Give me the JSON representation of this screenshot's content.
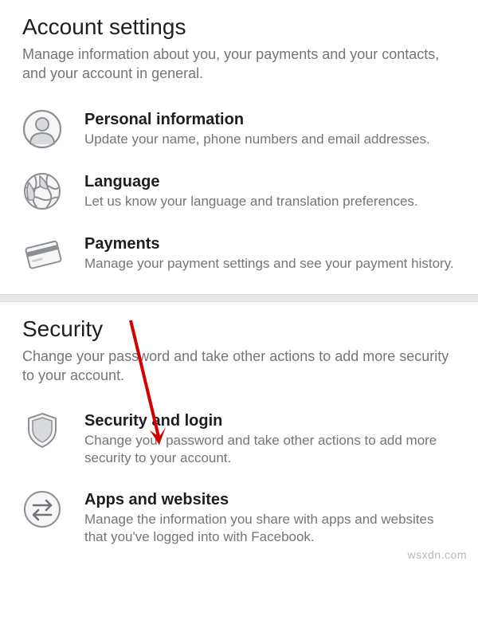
{
  "sections": [
    {
      "title": "Account settings",
      "desc": "Manage information about you, your payments and your contacts, and your account in general.",
      "items": [
        {
          "title": "Personal information",
          "desc": "Update your name, phone numbers and email addresses."
        },
        {
          "title": "Language",
          "desc": "Let us know your language and translation preferences."
        },
        {
          "title": "Payments",
          "desc": "Manage your payment settings and see your payment history."
        }
      ]
    },
    {
      "title": "Security",
      "desc": "Change your password and take other actions to add more security to your account.",
      "items": [
        {
          "title": "Security and login",
          "desc": "Change your password and take other actions to add more security to your account."
        },
        {
          "title": "Apps and websites",
          "desc": "Manage the information you share with apps and websites that you've logged into with Facebook."
        }
      ]
    }
  ],
  "watermark": "wsxdn.com"
}
